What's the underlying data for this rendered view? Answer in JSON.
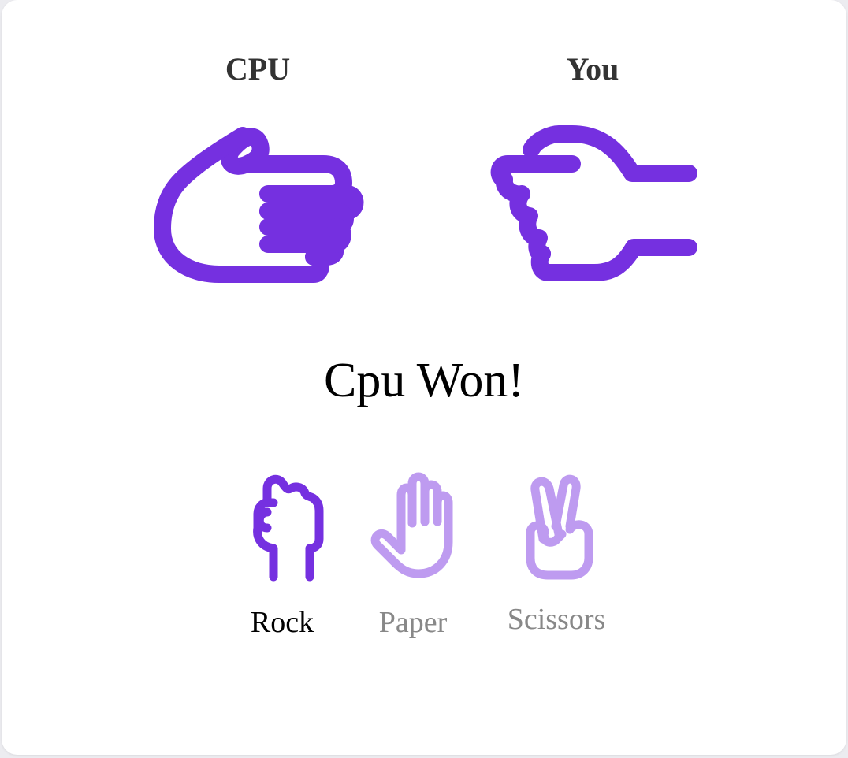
{
  "players": {
    "cpu_label": "CPU",
    "you_label": "You"
  },
  "result_text": "Cpu Won!",
  "choices": [
    {
      "label": "Rock",
      "icon": "rock-fist-icon",
      "selected": true
    },
    {
      "label": "Paper",
      "icon": "paper-hand-icon",
      "selected": false
    },
    {
      "label": "Scissors",
      "icon": "scissors-hand-icon",
      "selected": false
    }
  ],
  "cpu_hand_icon": "paper-hand-sideways-icon",
  "you_hand_icon": "rock-fist-sideways-icon",
  "colors": {
    "accent": "#7530E0",
    "accent_light": "#BE9BF0",
    "label_active": "#000000",
    "label_inactive": "#888888"
  }
}
